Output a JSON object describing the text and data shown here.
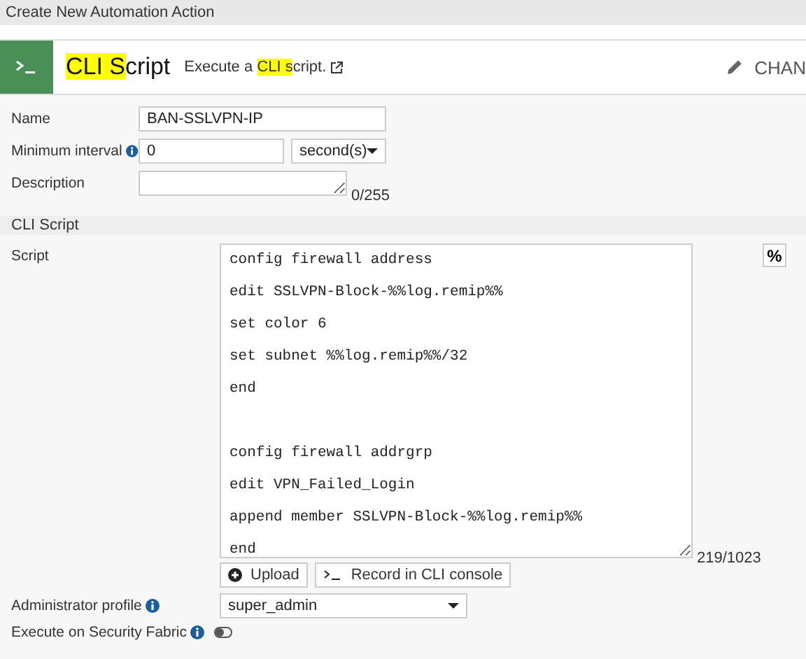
{
  "window": {
    "title": "Create New Automation Action"
  },
  "header": {
    "title": [
      {
        "text": "CLI S",
        "highlighted": true
      },
      {
        "text": "cript",
        "highlighted": false
      }
    ],
    "description": [
      {
        "text": "Execute a ",
        "highlighted": false
      },
      {
        "text": "CLI s",
        "highlighted": true
      },
      {
        "text": "cript.",
        "highlighted": false
      }
    ],
    "change_button": "CHAN"
  },
  "fields": [
    {
      "label": "Name",
      "value": "BAN-SSLVPN-IP"
    },
    {
      "label": "Minimum interval",
      "info": true,
      "value": "0",
      "unit": "second(s)"
    },
    {
      "label": "Description",
      "counter": "0/255"
    }
  ],
  "section": "CLI Script",
  "script": {
    "label": "Script",
    "insert_button": "%",
    "value": "config firewall address\nedit SSLVPN-Block-%%log.remip%%\nset color 6\nset subnet %%log.remip%%/32\nend\n\nconfig firewall addrgrp\nedit VPN_Failed_Login\nappend member SSLVPN-Block-%%log.remip%%\nend",
    "counter": "219/1023",
    "buttons": [
      {
        "label": "Upload",
        "kind": "upload"
      },
      {
        "label": "Record in CLI console",
        "kind": "console"
      }
    ]
  },
  "admin_profile": {
    "label": "Administrator profile",
    "value": "super_admin"
  },
  "security_fabric": {
    "label": "Execute on Security Fabric",
    "on": false
  }
}
